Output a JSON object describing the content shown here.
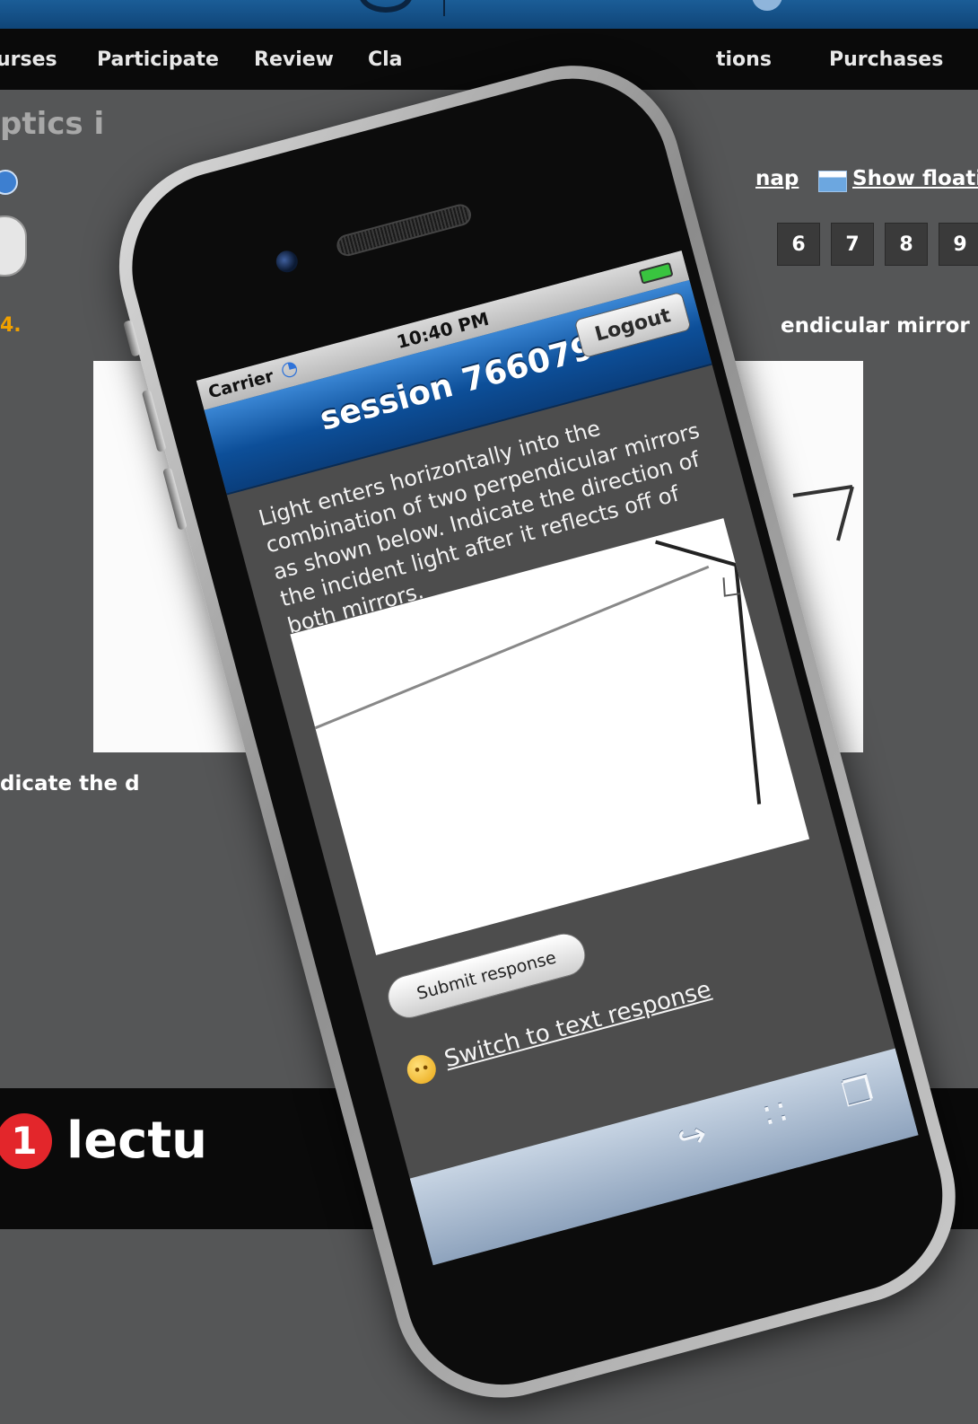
{
  "web": {
    "nav": [
      "urses",
      "Participate",
      "Review",
      "Cla",
      "tions",
      "Purchases"
    ],
    "title": "ptics i",
    "link_map": "nap",
    "link_float": "Show floatir",
    "pages": [
      "6",
      "7",
      "8",
      "9"
    ],
    "question_number": "4.",
    "question_tail": "endicular mirror",
    "indicate_line": "dicate the d",
    "badge": "1",
    "lecture": "lectu"
  },
  "phone": {
    "carrier": "Carrier",
    "time": "10:40 PM",
    "session_title": "session 766079",
    "logout_label": "Logout",
    "question": "Light enters horizontally into the combination of two perpendicular mirrors as shown below. Indicate the direction of the incident light after it reflects off of both mirrors.",
    "submit_label": "Submit response",
    "switch_label": "Switch to text response"
  },
  "icons": {
    "wifi": "wifi-icon",
    "share": "share-icon",
    "bookmarks": "bookmarks-icon",
    "tabs": "tabs-icon",
    "emoji": "confused-face-icon"
  },
  "colors": {
    "nav_bg": "#0a0a0a",
    "title_bar": "#0d4f99",
    "page_bg": "#555657",
    "badge": "#e3262b",
    "question_number": "#f0a000"
  }
}
